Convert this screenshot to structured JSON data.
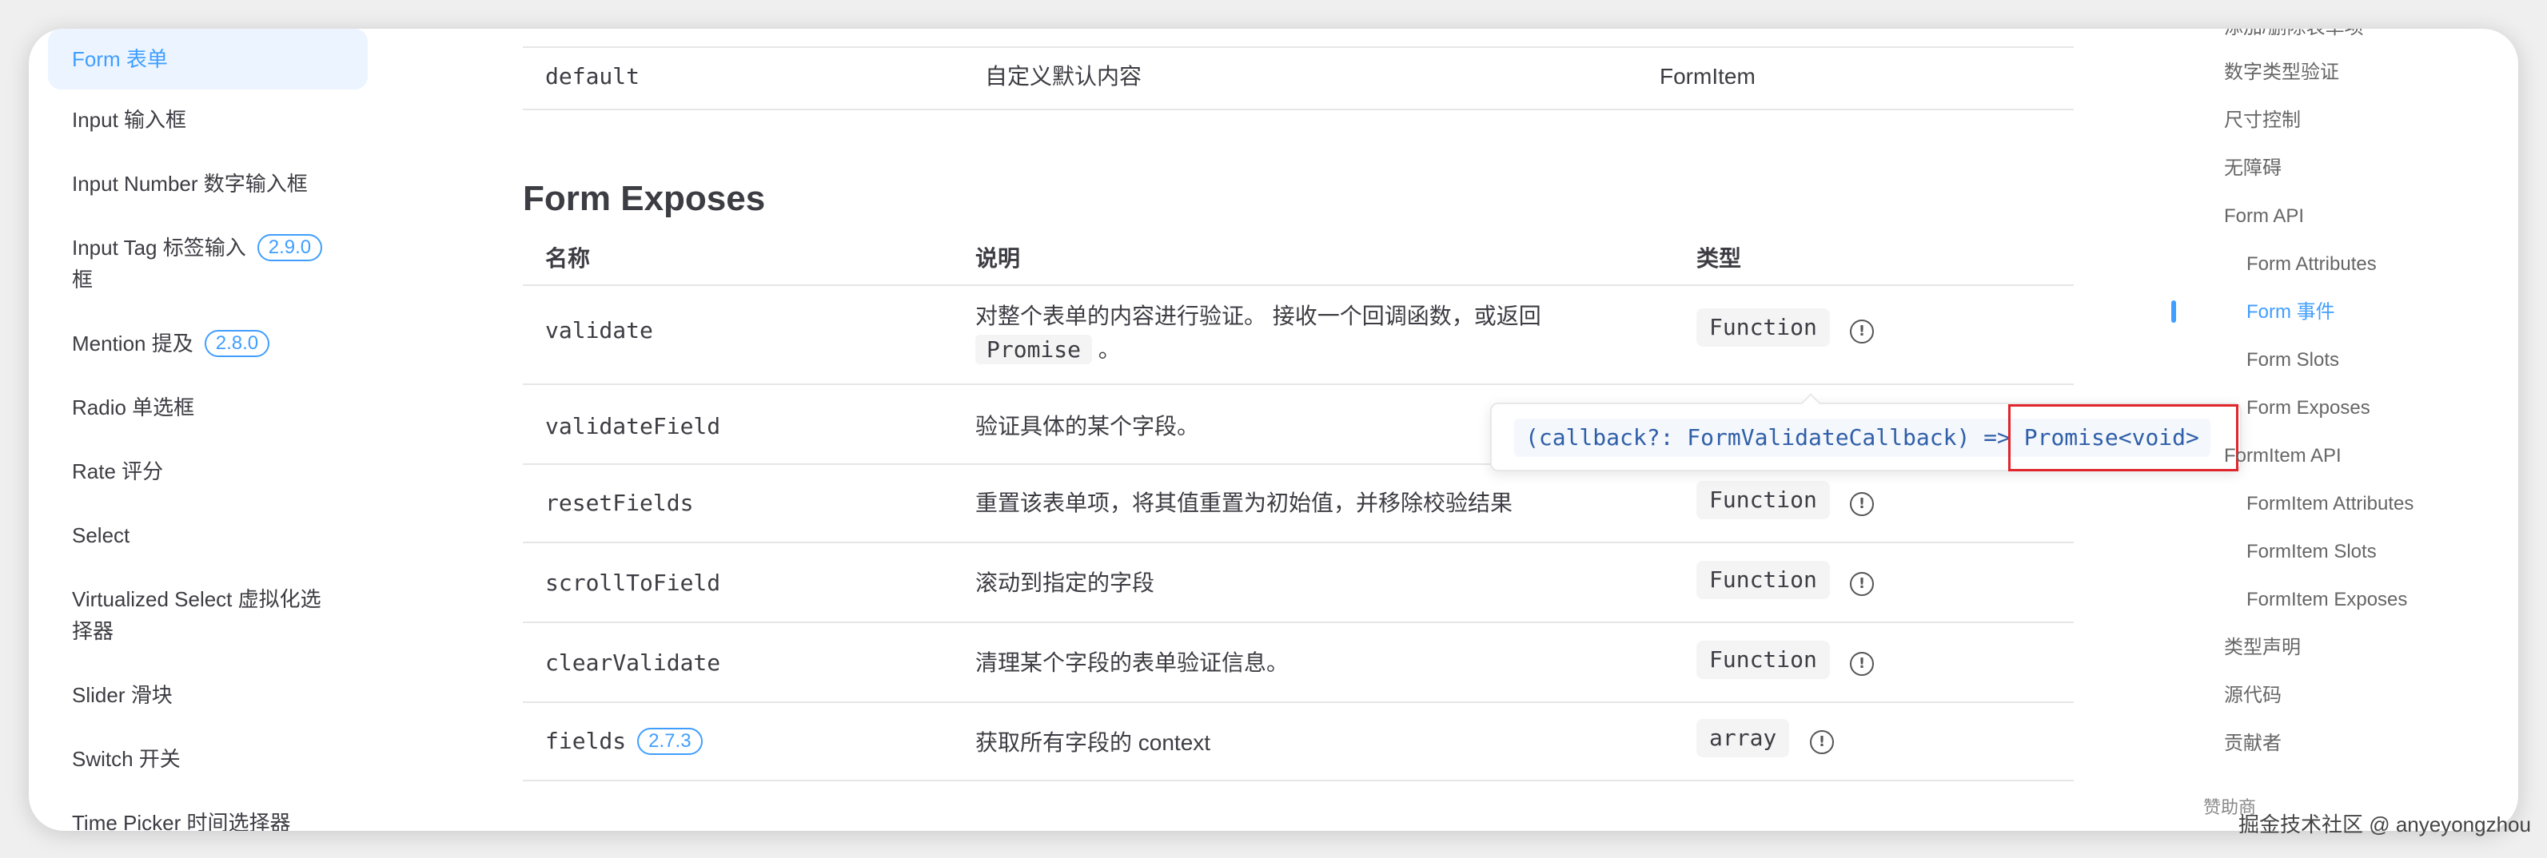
{
  "sidebar": {
    "items": [
      {
        "label": "Form 表单",
        "badge": ""
      },
      {
        "label": "Input 输入框",
        "badge": ""
      },
      {
        "label": "Input Number 数字输入框",
        "badge": ""
      },
      {
        "label": "Input Tag 标签输入",
        "label2": "框",
        "badge": "2.9.0"
      },
      {
        "label": "Mention 提及",
        "badge": "2.8.0"
      },
      {
        "label": "Radio 单选框",
        "badge": ""
      },
      {
        "label": "Rate 评分",
        "badge": ""
      },
      {
        "label": "Select",
        "badge": ""
      },
      {
        "label": "Virtualized Select 虚拟化选",
        "label2": "择器",
        "badge": ""
      },
      {
        "label": "Slider 滑块",
        "badge": ""
      },
      {
        "label": "Switch 开关",
        "badge": ""
      },
      {
        "label": "Time Picker 时间选择器",
        "badge": ""
      }
    ]
  },
  "top_row": {
    "name": "default",
    "desc": "自定义默认内容",
    "type": "FormItem"
  },
  "section": {
    "title": "Form Exposes",
    "headers": {
      "name": "名称",
      "desc": "说明",
      "type": "类型"
    },
    "rows": [
      {
        "name": "validate",
        "badge": "",
        "desc": "对整个表单的内容进行验证。 接收一个回调函数，或返回",
        "desc_code": "Promise",
        "desc_tail": "。",
        "type": "Function"
      },
      {
        "name": "validateField",
        "badge": "",
        "desc": "验证具体的某个字段。",
        "type": ""
      },
      {
        "name": "resetFields",
        "badge": "",
        "desc": "重置该表单项，将其值重置为初始值，并移除校验结果",
        "type": "Function"
      },
      {
        "name": "scrollToField",
        "badge": "",
        "desc": "滚动到指定的字段",
        "type": "Function"
      },
      {
        "name": "clearValidate",
        "badge": "",
        "desc": "清理某个字段的表单验证信息。",
        "type": "Function"
      },
      {
        "name": "fields",
        "badge": "2.7.3",
        "desc": "获取所有字段的 context",
        "type": "array"
      }
    ]
  },
  "tooltip": {
    "code": "(callback?: FormValidateCallback) => Promise<void>"
  },
  "toc": {
    "items": [
      {
        "label": "添加/删除表单项",
        "level": 1
      },
      {
        "label": "数字类型验证",
        "level": 1
      },
      {
        "label": "尺寸控制",
        "level": 1
      },
      {
        "label": "无障碍",
        "level": 1
      },
      {
        "label": "Form API",
        "level": 1
      },
      {
        "label": "Form Attributes",
        "level": 2
      },
      {
        "label": "Form 事件",
        "level": 2
      },
      {
        "label": "Form Slots",
        "level": 2
      },
      {
        "label": "Form Exposes",
        "level": 2
      },
      {
        "label": "FormItem API",
        "level": 1
      },
      {
        "label": "FormItem Attributes",
        "level": 2
      },
      {
        "label": "FormItem Slots",
        "level": 2
      },
      {
        "label": "FormItem Exposes",
        "level": 2
      },
      {
        "label": "类型声明",
        "level": 1
      },
      {
        "label": "源代码",
        "level": 1
      },
      {
        "label": "贡献者",
        "level": 1
      },
      {
        "label": "赞助商",
        "level": 1
      }
    ]
  },
  "watermark": "掘金技术社区 @ anyeyongzhou",
  "colors": {
    "accent": "#409eff",
    "highlight_box": "#e0262c"
  }
}
